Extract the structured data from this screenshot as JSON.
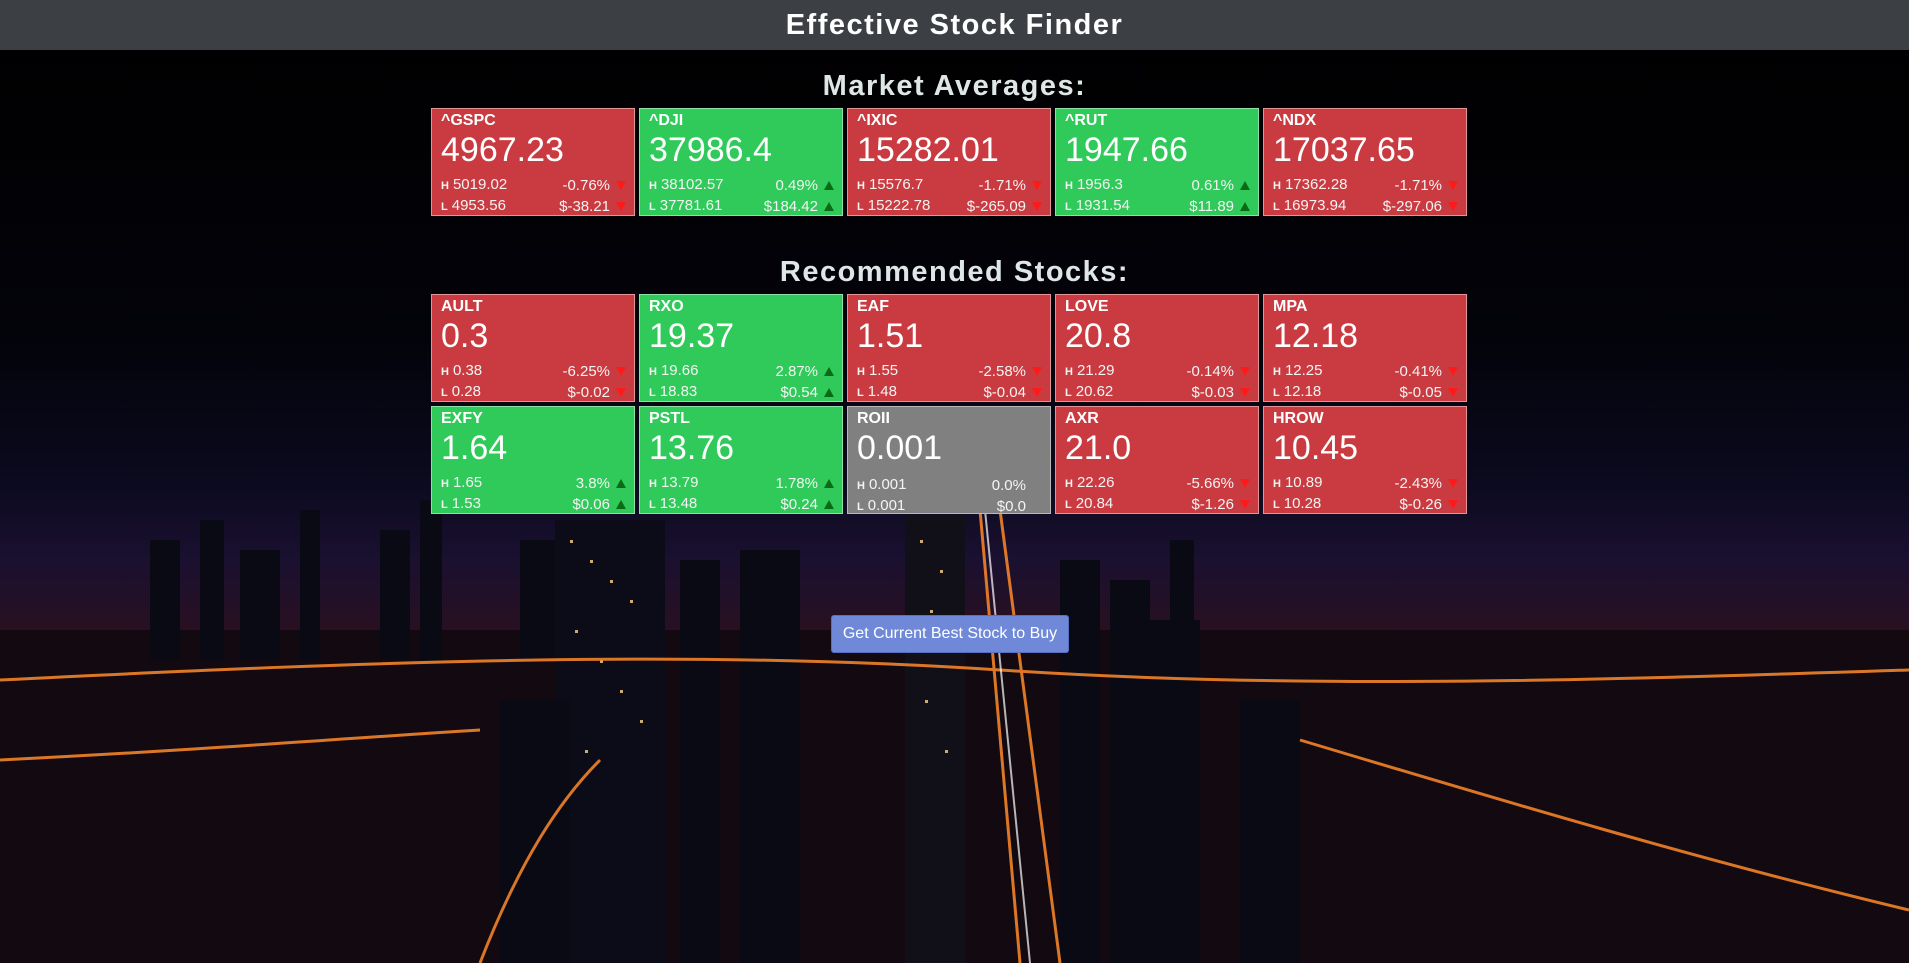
{
  "app": {
    "title": "Effective Stock Finder"
  },
  "market": {
    "title": "Market Averages:",
    "cards": [
      {
        "symbol": "^GSPC",
        "price": "4967.23",
        "high": "5019.02",
        "low": "4953.56",
        "pct": "-0.76%",
        "change": "$-38.21",
        "trend": "down"
      },
      {
        "symbol": "^DJI",
        "price": "37986.4",
        "high": "38102.57",
        "low": "37781.61",
        "pct": "0.49%",
        "change": "$184.42",
        "trend": "up"
      },
      {
        "symbol": "^IXIC",
        "price": "15282.01",
        "high": "15576.7",
        "low": "15222.78",
        "pct": "-1.71%",
        "change": "$-265.09",
        "trend": "down"
      },
      {
        "symbol": "^RUT",
        "price": "1947.66",
        "high": "1956.3",
        "low": "1931.54",
        "pct": "0.61%",
        "change": "$11.89",
        "trend": "up"
      },
      {
        "symbol": "^NDX",
        "price": "17037.65",
        "high": "17362.28",
        "low": "16973.94",
        "pct": "-1.71%",
        "change": "$-297.06",
        "trend": "down"
      }
    ]
  },
  "recommended": {
    "title": "Recommended Stocks:",
    "cards": [
      {
        "symbol": "AULT",
        "price": "0.3",
        "high": "0.38",
        "low": "0.28",
        "pct": "-6.25%",
        "change": "$-0.02",
        "trend": "down"
      },
      {
        "symbol": "RXO",
        "price": "19.37",
        "high": "19.66",
        "low": "18.83",
        "pct": "2.87%",
        "change": "$0.54",
        "trend": "up"
      },
      {
        "symbol": "EAF",
        "price": "1.51",
        "high": "1.55",
        "low": "1.48",
        "pct": "-2.58%",
        "change": "$-0.04",
        "trend": "down"
      },
      {
        "symbol": "LOVE",
        "price": "20.8",
        "high": "21.29",
        "low": "20.62",
        "pct": "-0.14%",
        "change": "$-0.03",
        "trend": "down"
      },
      {
        "symbol": "MPA",
        "price": "12.18",
        "high": "12.25",
        "low": "12.18",
        "pct": "-0.41%",
        "change": "$-0.05",
        "trend": "down"
      },
      {
        "symbol": "EXFY",
        "price": "1.64",
        "high": "1.65",
        "low": "1.53",
        "pct": "3.8%",
        "change": "$0.06",
        "trend": "up"
      },
      {
        "symbol": "PSTL",
        "price": "13.76",
        "high": "13.79",
        "low": "13.48",
        "pct": "1.78%",
        "change": "$0.24",
        "trend": "up"
      },
      {
        "symbol": "ROII",
        "price": "0.001",
        "high": "0.001",
        "low": "0.001",
        "pct": "0.0%",
        "change": "$0.0",
        "trend": "flat"
      },
      {
        "symbol": "AXR",
        "price": "21.0",
        "high": "22.26",
        "low": "20.84",
        "pct": "-5.66%",
        "change": "$-1.26",
        "trend": "down"
      },
      {
        "symbol": "HROW",
        "price": "10.45",
        "high": "10.89",
        "low": "10.28",
        "pct": "-2.43%",
        "change": "$-0.26",
        "trend": "down"
      }
    ]
  },
  "labels": {
    "high": "H",
    "low": "L"
  },
  "actions": {
    "best_stock_button": "Get Current Best Stock to Buy"
  },
  "colors": {
    "up": "#2fca5a",
    "down": "#c93b40",
    "flat": "#808080",
    "header": "#3c3f44",
    "button": "#6f89d8"
  }
}
